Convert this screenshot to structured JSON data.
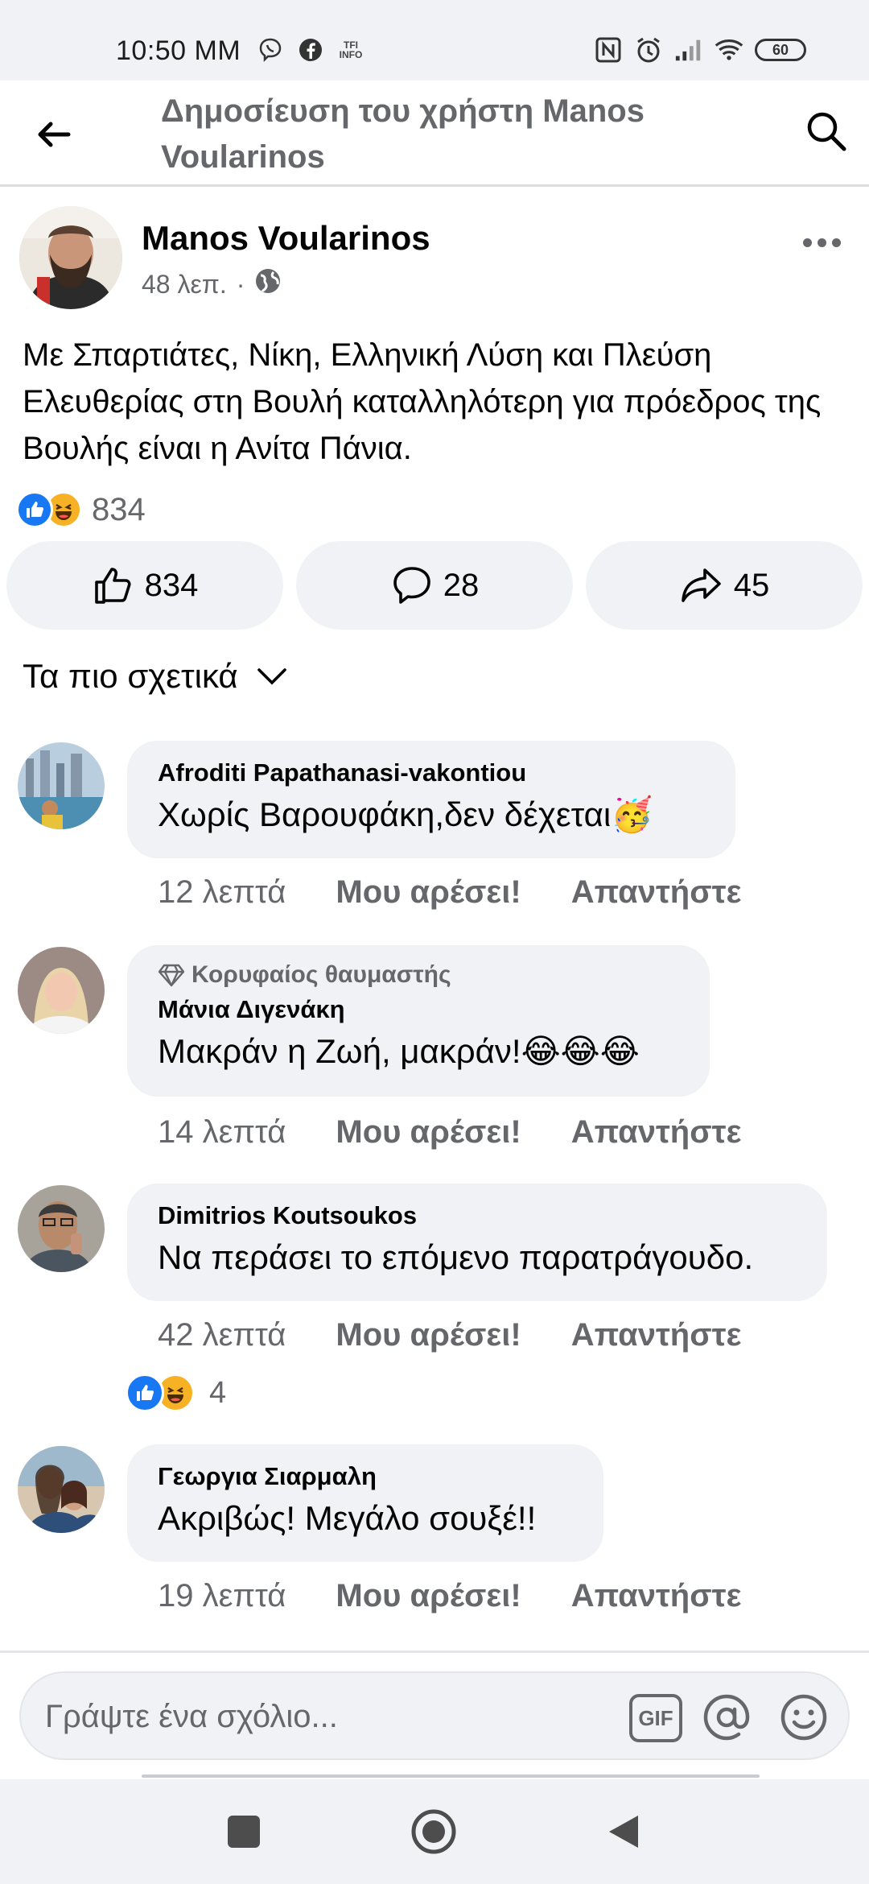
{
  "status_bar": {
    "time": "10:50 MM",
    "left_icons": [
      "viber-icon",
      "facebook-icon",
      "tfi-info-icon"
    ],
    "tfi_text": "TFI INFO",
    "right_icons": [
      "nfc-icon",
      "alarm-icon",
      "signal-icon",
      "wifi-icon"
    ],
    "battery": "60"
  },
  "header": {
    "title": "Δημοσίευση του χρήστη Manos Voularinos"
  },
  "post": {
    "author": "Manos Voularinos",
    "time": "48 λεπ.",
    "separator": "·",
    "privacy_icon": "globe-icon",
    "text": "Με Σπαρτιάτες, Νίκη, Ελληνική Λύση και Πλεύση Ελευθερίας στη Βουλή καταλληλότερη για πρόεδρος της Βουλής είναι η Ανίτα Πάνια.",
    "reaction_count": "834",
    "actions": {
      "like_count": "834",
      "comment_count": "28",
      "share_count": "45"
    }
  },
  "sort": {
    "label": "Τα πιο σχετικά"
  },
  "comments": [
    {
      "name": "Afroditi Papathanasi-vakontiou",
      "text": "Χωρίς Βαρουφάκη,δεν δέχεται🥳",
      "time": "12 λεπτά",
      "like": "Μου αρέσει!",
      "reply": "Απαντήστε"
    },
    {
      "badge": "Κορυφαίος θαυμαστής",
      "name": "Μάνια Διγενάκη",
      "text": "Μακράν η Ζωή, μακράν!😂😂😂",
      "time": "14 λεπτά",
      "like": "Μου αρέσει!",
      "reply": "Απαντήστε"
    },
    {
      "name": "Dimitrios Koutsoukos",
      "text": "Να περάσει το επόμενο παρατράγουδο.",
      "time": "42 λεπτά",
      "like": "Μου αρέσει!",
      "reply": "Απαντήστε",
      "reaction_count": "4"
    },
    {
      "name": "Γεωργια Σιαρμαλη",
      "text": "Ακριβώς! Μεγάλο σουξέ!!",
      "time": "19 λεπτά",
      "like": "Μου αρέσει!",
      "reply": "Απαντήστε"
    }
  ],
  "composer": {
    "placeholder": "Γράψτε ένα σχόλιο...",
    "gif_label": "GIF"
  },
  "colors": {
    "accent": "#1877f2",
    "secondary_text": "#65676b",
    "bubble": "#f0f2f5",
    "haha": "#f7b125"
  }
}
